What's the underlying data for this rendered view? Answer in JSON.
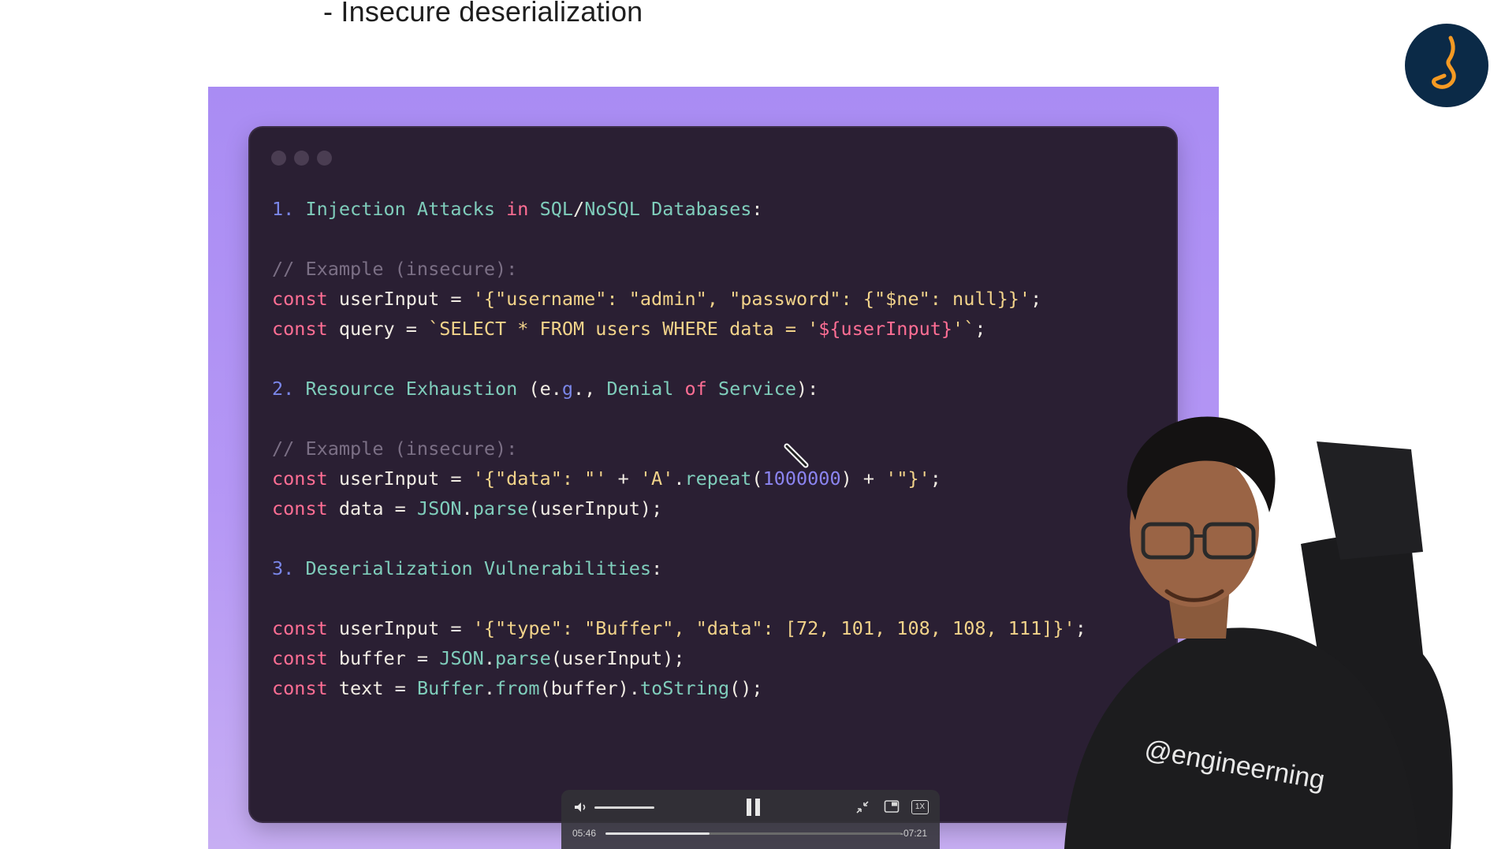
{
  "slide": {
    "bullet_text": "- Insecure deserialization"
  },
  "code_lines": [
    [
      [
        "num",
        "1. "
      ],
      [
        "head",
        "Injection Attacks "
      ],
      [
        "kw",
        "in "
      ],
      [
        "head",
        "SQL"
      ],
      [
        "plain",
        "/"
      ],
      [
        "head",
        "NoSQL Databases"
      ],
      [
        "plain",
        ":"
      ]
    ],
    [],
    [
      [
        "cmt",
        "// Example (insecure):"
      ]
    ],
    [
      [
        "kw",
        "const "
      ],
      [
        "plain",
        "userInput = "
      ],
      [
        "str",
        "'{\"username\": \"admin\", \"password\": {\"$ne\": null}}'"
      ],
      [
        "plain",
        ";"
      ]
    ],
    [
      [
        "kw",
        "const "
      ],
      [
        "plain",
        "query = "
      ],
      [
        "str",
        "`SELECT * FROM users WHERE data = '"
      ],
      [
        "tmpl",
        "${userInput}"
      ],
      [
        "str",
        "'`"
      ],
      [
        "plain",
        ";"
      ]
    ],
    [],
    [
      [
        "num",
        "2. "
      ],
      [
        "head",
        "Resource Exhaustion "
      ],
      [
        "plain",
        "(e."
      ],
      [
        "num",
        "g"
      ],
      [
        "plain",
        "., "
      ],
      [
        "head",
        "Denial "
      ],
      [
        "kw",
        "of "
      ],
      [
        "head",
        "Service"
      ],
      [
        "plain",
        "):"
      ]
    ],
    [],
    [
      [
        "cmt",
        "// Example (insecure):"
      ]
    ],
    [
      [
        "kw",
        "const "
      ],
      [
        "plain",
        "userInput = "
      ],
      [
        "str",
        "'{\"data\": \"'"
      ],
      [
        "plain",
        " + "
      ],
      [
        "str",
        "'A'"
      ],
      [
        "plain",
        "."
      ],
      [
        "fn",
        "repeat"
      ],
      [
        "plain",
        "("
      ],
      [
        "numlit",
        "1000000"
      ],
      [
        "plain",
        ") + "
      ],
      [
        "str",
        "'\"}'"
      ],
      [
        "plain",
        ";"
      ]
    ],
    [
      [
        "kw",
        "const "
      ],
      [
        "plain",
        "data = "
      ],
      [
        "fn",
        "JSON"
      ],
      [
        "plain",
        "."
      ],
      [
        "fn",
        "parse"
      ],
      [
        "plain",
        "(userInput);"
      ]
    ],
    [],
    [
      [
        "num",
        "3. "
      ],
      [
        "head",
        "Deserialization Vulnerabilities"
      ],
      [
        "plain",
        ":"
      ]
    ],
    [],
    [
      [
        "kw",
        "const "
      ],
      [
        "plain",
        "userInput = "
      ],
      [
        "str",
        "'{\"type\": \"Buffer\", \"data\": [72, 101, 108, 108, 111]}'"
      ],
      [
        "plain",
        ";"
      ]
    ],
    [
      [
        "kw",
        "const "
      ],
      [
        "plain",
        "buffer = "
      ],
      [
        "fn",
        "JSON"
      ],
      [
        "plain",
        "."
      ],
      [
        "fn",
        "parse"
      ],
      [
        "plain",
        "(userInput);"
      ]
    ],
    [
      [
        "kw",
        "const "
      ],
      [
        "plain",
        "text = "
      ],
      [
        "fn",
        "Buffer"
      ],
      [
        "plain",
        "."
      ],
      [
        "fn",
        "from"
      ],
      [
        "plain",
        "(buffer)."
      ],
      [
        "fn",
        "toString"
      ],
      [
        "plain",
        "();"
      ]
    ]
  ],
  "presenter": {
    "shirt_text": "@engineerning"
  },
  "player": {
    "elapsed": "05:46",
    "remaining": "-07:21",
    "speed_label": "1X",
    "progress": 0.35,
    "volume": 1.0
  },
  "icons": {
    "logo": "channel-logo-icon",
    "volume": "volume-icon",
    "pause": "pause-icon",
    "exit_fullscreen": "collapse-icon",
    "pip": "picture-in-picture-icon",
    "speed": "playback-speed-icon"
  },
  "colors": {
    "slide_purple": "#b597f5",
    "code_bg": "#2a1f33",
    "keyword": "#ff6e94",
    "heading": "#7fcdbb",
    "string": "#f2d38a",
    "comment": "#7b6f85"
  }
}
